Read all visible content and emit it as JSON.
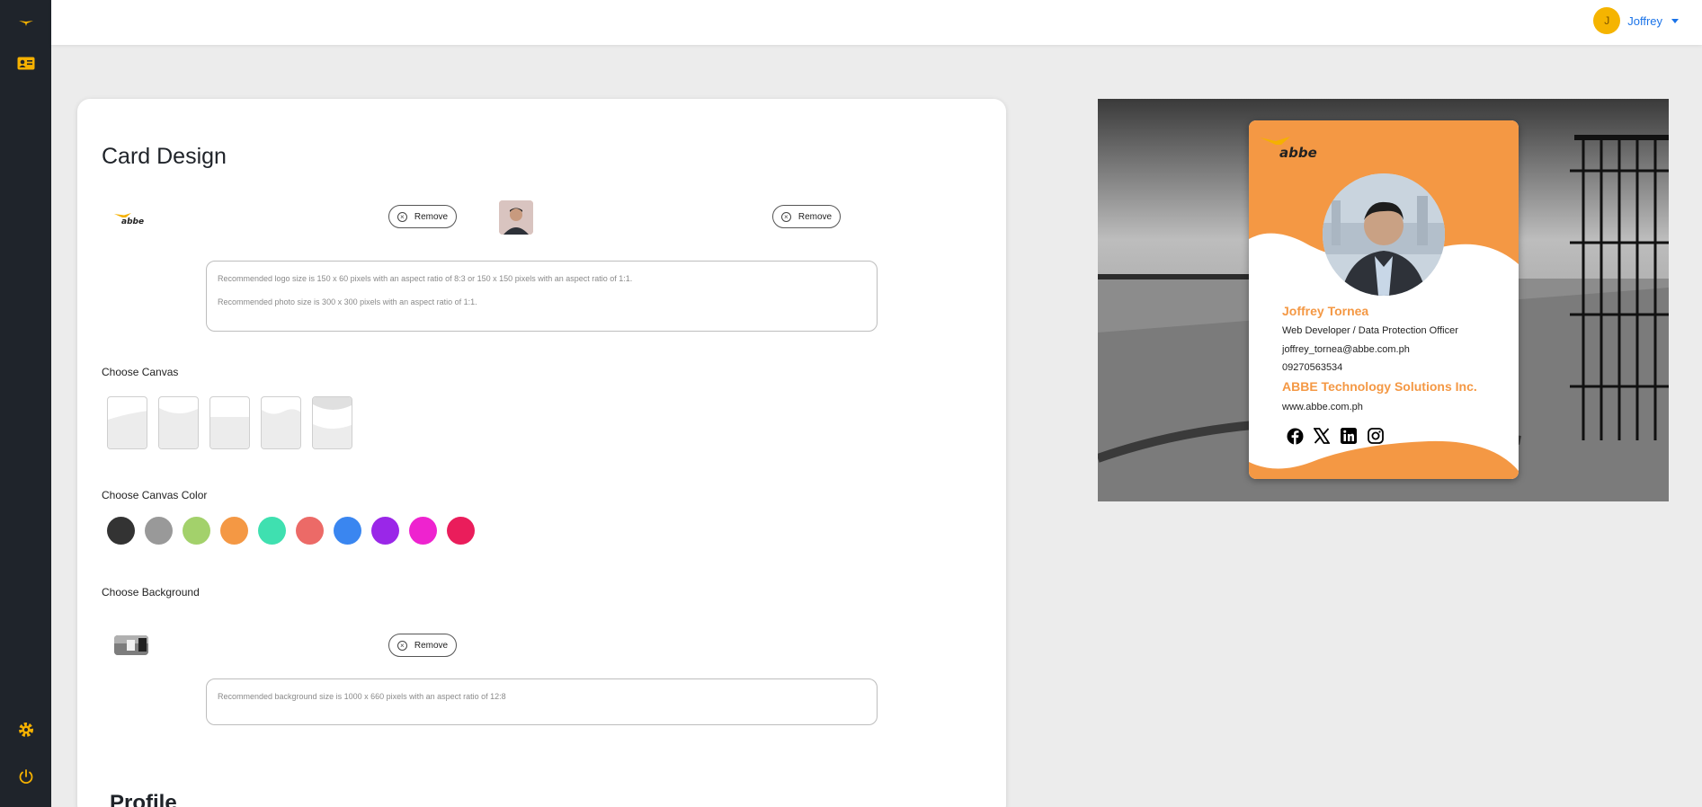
{
  "sidebar": {
    "icons": [
      "menu-toggle-icon",
      "id-card-icon",
      "gear-icon",
      "power-icon"
    ]
  },
  "header": {
    "user": {
      "initial": "J",
      "name": "Joffrey"
    }
  },
  "card_design": {
    "title": "Card Design",
    "remove_label": "Remove",
    "logo_note": "Recommended logo size is 150 x 60 pixels with an aspect ratio of 8:3 or 150 x 150 pixels with an aspect ratio of 1:1.",
    "photo_note": "Recommended photo size is 300 x 300 pixels with an aspect ratio of 1:1.",
    "choose_canvas": "Choose Canvas",
    "choose_canvas_color": "Choose Canvas Color",
    "canvas_colors": [
      "#333333",
      "#999999",
      "#a3d16b",
      "#f49844",
      "#3fe0b0",
      "#ec6a67",
      "#3a86f0",
      "#9a27e8",
      "#ee23cf",
      "#ea1d5b"
    ],
    "choose_background": "Choose Background",
    "background_note": "Recommended background size is 1000 x 660 pixels with an aspect ratio of 12:8",
    "profile_heading": "Profile"
  },
  "preview_card": {
    "logo_text": "abbe",
    "name": "Joffrey Tornea",
    "position": "Web Developer / Data Protection Officer",
    "email": "joffrey_tornea@abbe.com.ph",
    "phone": "09270563534",
    "company": "ABBE Technology Solutions Inc.",
    "website": "www.abbe.com.ph",
    "accent_color": "#f49844",
    "social_icons": [
      "facebook-icon",
      "x-icon",
      "linkedin-icon",
      "instagram-icon"
    ]
  }
}
